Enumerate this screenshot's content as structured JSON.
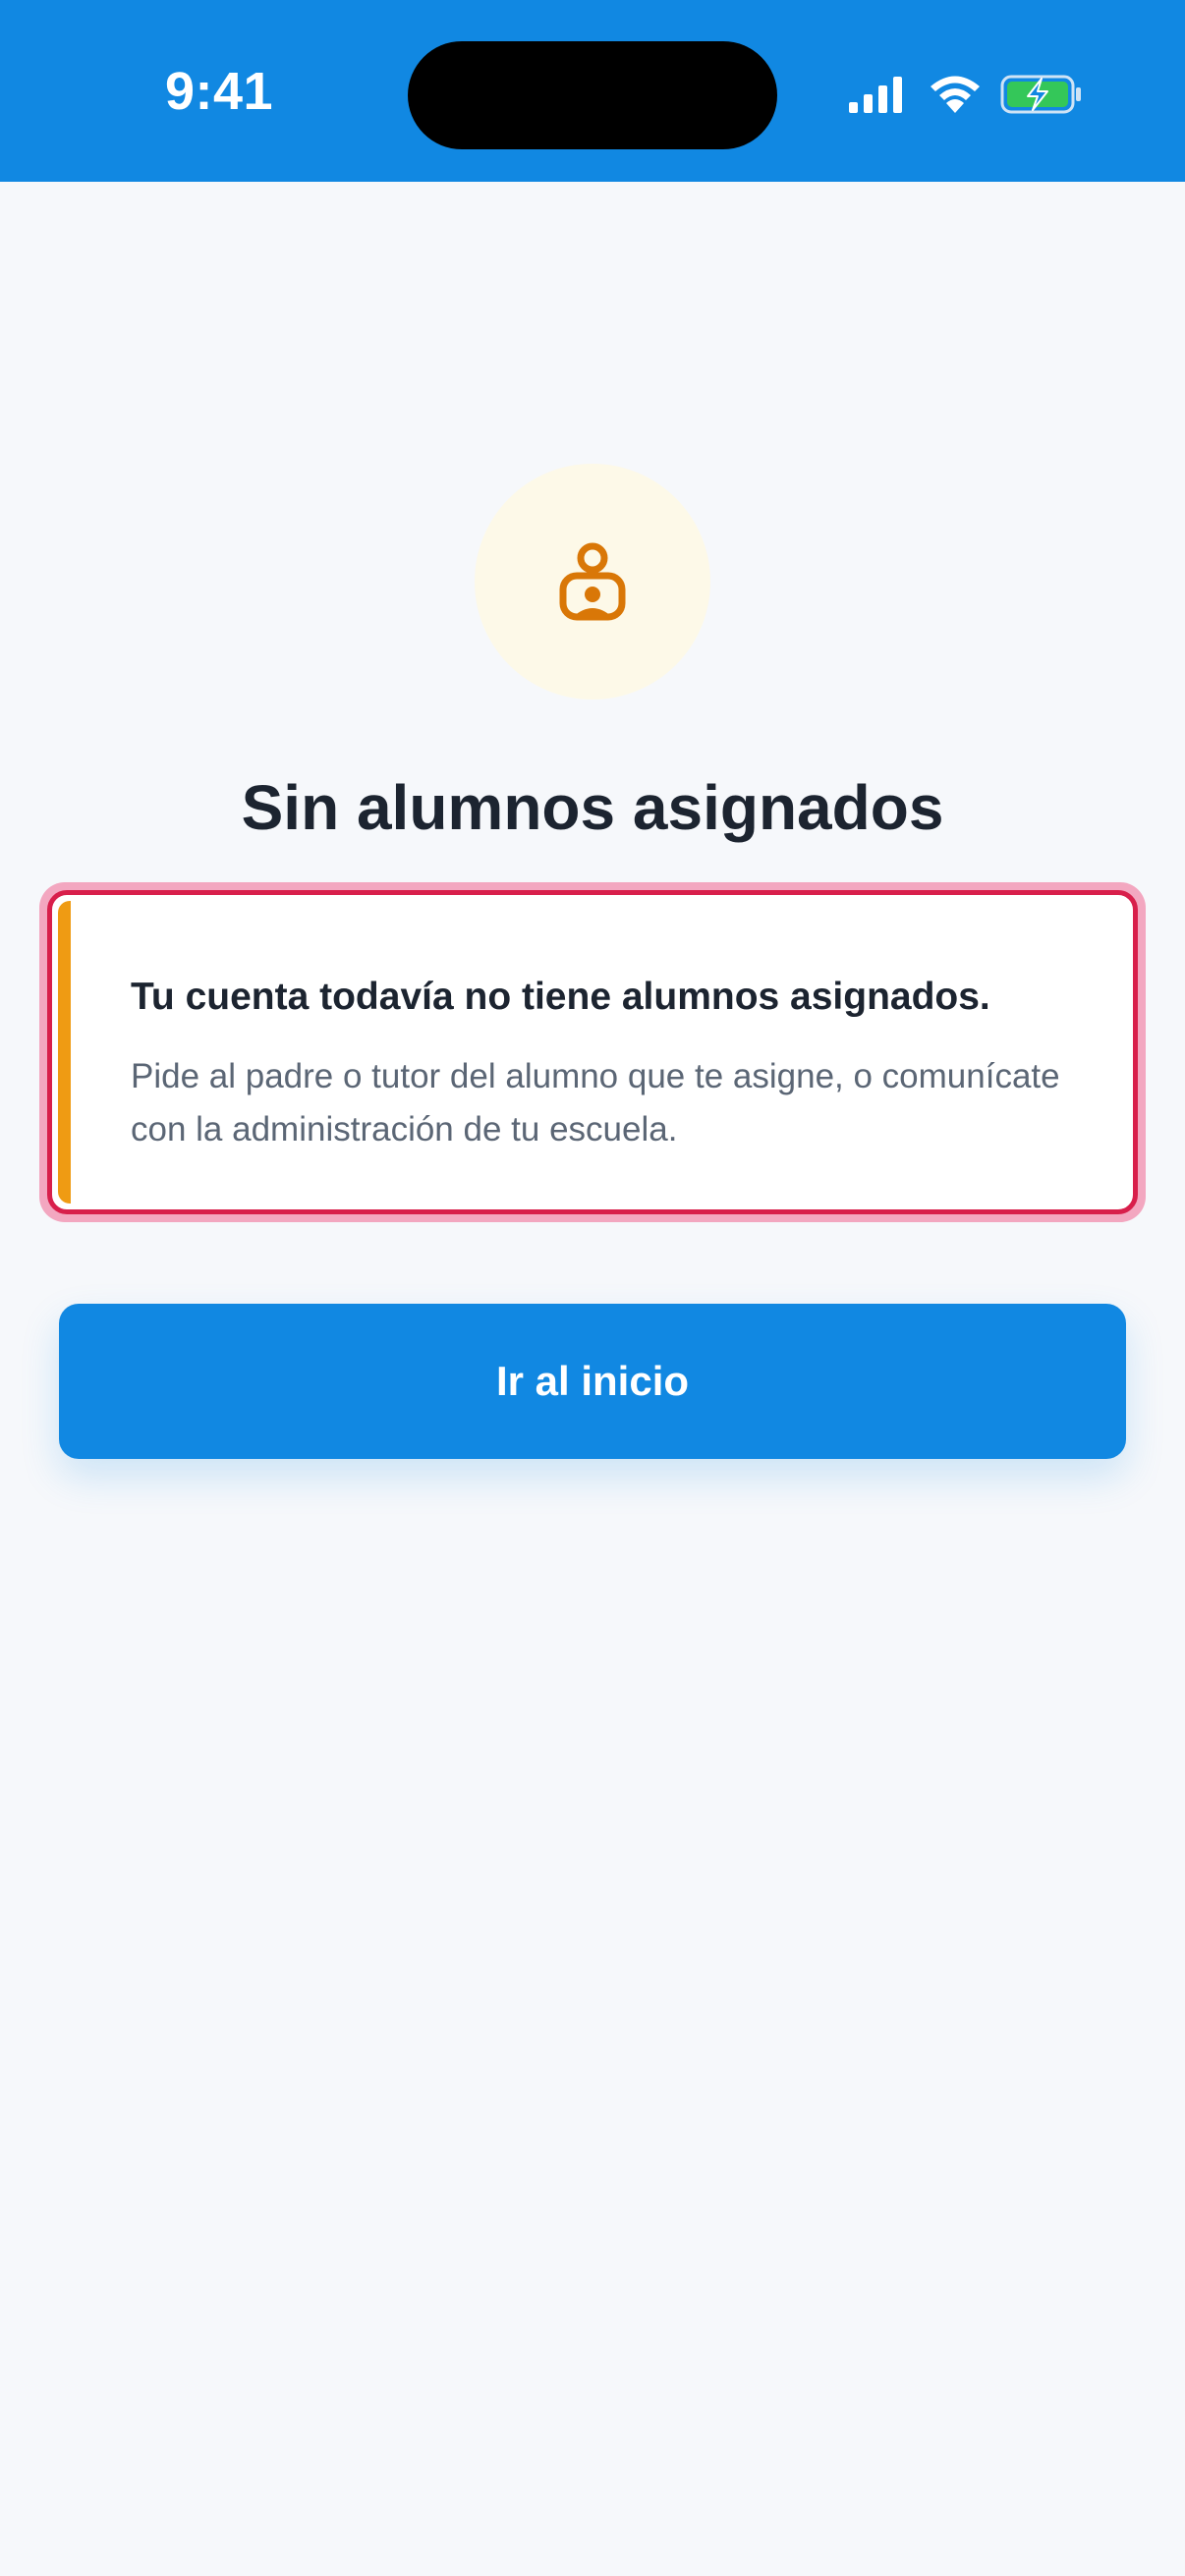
{
  "status_bar": {
    "time": "9:41",
    "icons": [
      "signal-icon",
      "wifi-icon",
      "battery-charging-icon"
    ]
  },
  "empty_state": {
    "icon": "student-badge-icon",
    "title": "Sin alumnos asignados"
  },
  "notice": {
    "heading": "Tu cuenta todavía no tiene alumnos asignados.",
    "body": "Pide al padre o tutor del alumno que te asigne, o comunícate con la administración de tu escuela."
  },
  "actions": {
    "primary_label": "Ir al inicio"
  },
  "colors": {
    "primary": "#1188e2",
    "warning_accent": "#ef9b13",
    "highlight_border": "#d81f4b",
    "icon_tint": "#d97707",
    "icon_bg": "#fdf9e8"
  }
}
